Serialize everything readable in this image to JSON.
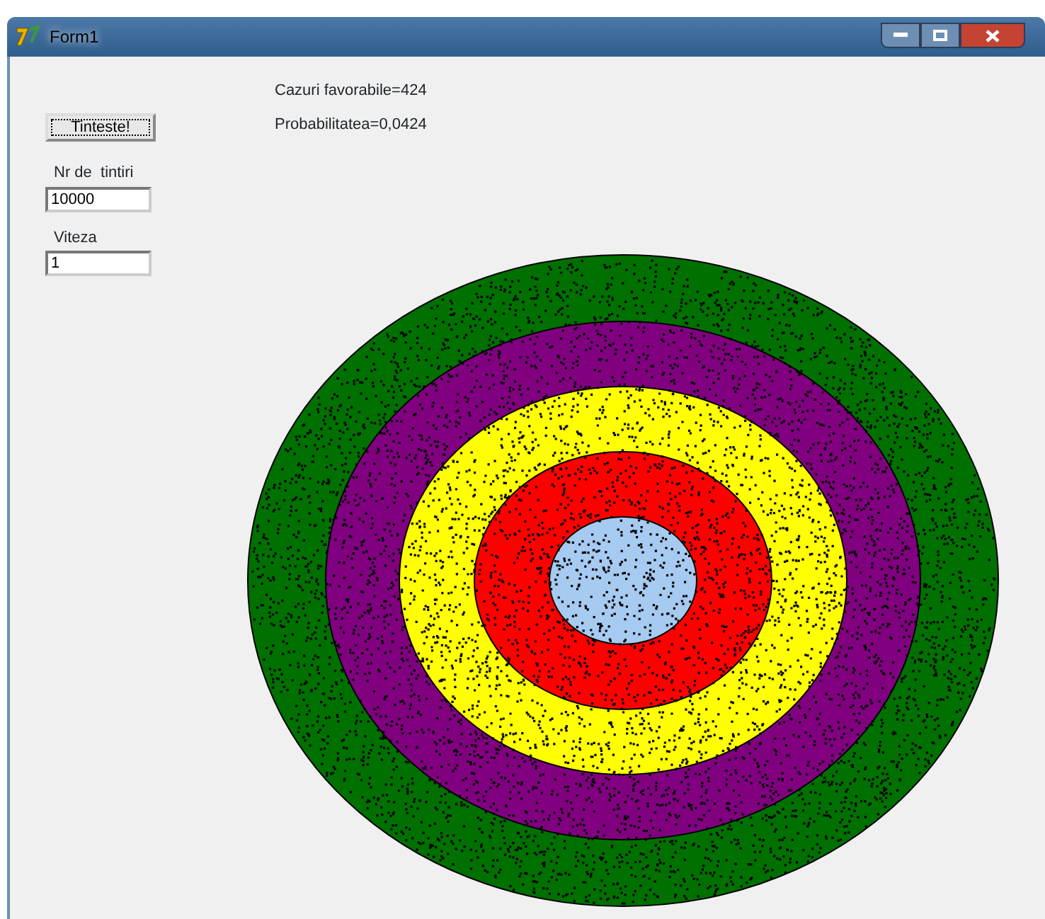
{
  "window": {
    "title": "Form1"
  },
  "button": {
    "label": "Tinteste!"
  },
  "fields": [
    {
      "label": "Nr de  tintiri",
      "value": "10000"
    },
    {
      "label": "Viteza",
      "value": "1"
    }
  ],
  "results": [
    "Cazuri favorabile=424",
    "Probabilitatea=0,0424"
  ],
  "target": {
    "rings": [
      {
        "color": "#007000"
      },
      {
        "color": "#800080"
      },
      {
        "color": "#ffff00"
      },
      {
        "color": "#ff0000"
      },
      {
        "color": "#a6caf0"
      }
    ]
  }
}
